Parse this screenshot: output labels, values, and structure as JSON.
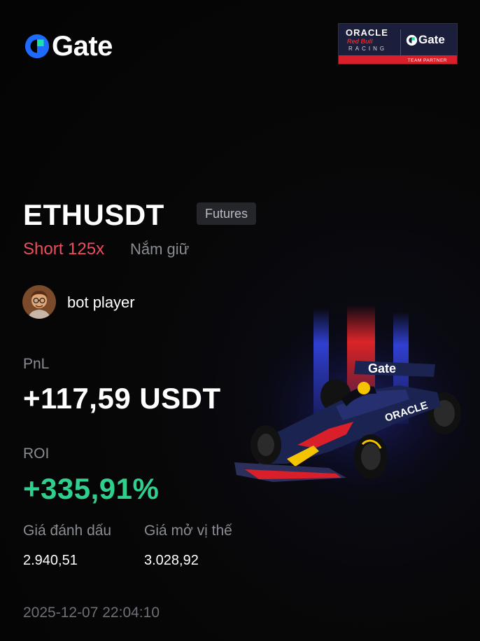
{
  "brand": {
    "logo_text": "Gate",
    "logo_icon": "gate-logo-icon",
    "accent": "#1f6bff",
    "accent_green": "#17e6a1"
  },
  "partner": {
    "oracle": "ORACLE",
    "redbull": "Red Bull",
    "racing": "RACING",
    "gate": "Gate",
    "footer": "TEAM PARTNER"
  },
  "position": {
    "pair": "ETHUSDT",
    "market_tag": "Futures",
    "direction": "Short 125x",
    "status": "Nắm giữ"
  },
  "user": {
    "name": "bot player",
    "avatar_icon": "user-avatar"
  },
  "pnl": {
    "label": "PnL",
    "value": "+117,59 USDT"
  },
  "roi": {
    "label": "ROI",
    "value": "+335,91%"
  },
  "prices": {
    "mark_label": "Giá đánh dấu",
    "mark_value": "2.940,51",
    "entry_label": "Giá mở vị thế",
    "entry_value": "3.028,92"
  },
  "timestamp": "2025-12-07 22:04:10",
  "colors": {
    "short": "#ef4d5e",
    "profit": "#2fcf8d",
    "muted": "#8a8c94",
    "car_body": "#1b2350",
    "car_red": "#d81f2a",
    "car_yellow": "#f5c400"
  },
  "car": {
    "sponsor_text": "Gate",
    "side_text": "ORACLE"
  }
}
